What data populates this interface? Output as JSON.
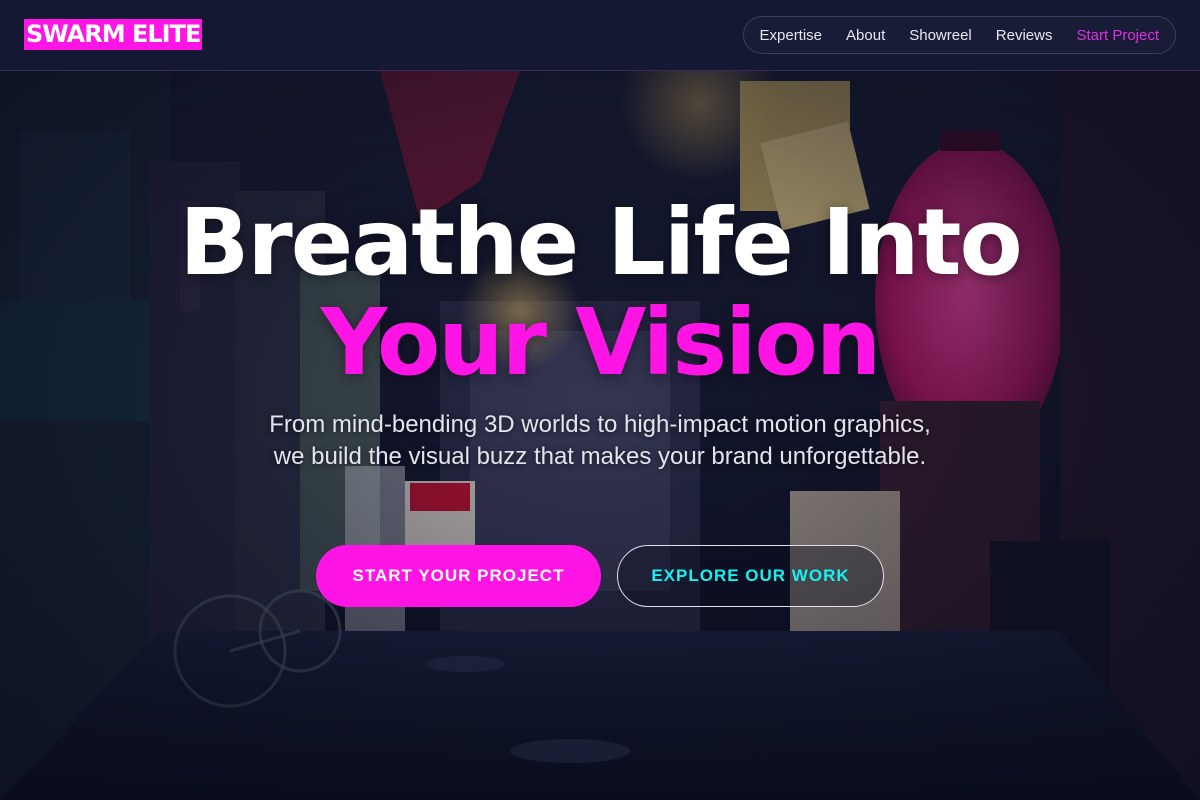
{
  "brand": {
    "logo_text": "SWARM ELITE",
    "accent": "#ff14e6",
    "cyan": "#19f0f0"
  },
  "nav": {
    "items": [
      {
        "label": "Expertise"
      },
      {
        "label": "About"
      },
      {
        "label": "Showreel"
      },
      {
        "label": "Reviews"
      },
      {
        "label": "Start Project"
      }
    ]
  },
  "hero": {
    "headline_line1": "Breathe Life Into",
    "headline_line2": "Your Vision",
    "subtitle": "From mind-bending 3D worlds to high-impact motion graphics, we build the visual buzz that makes your brand unforgettable.",
    "primary_cta": "START YOUR PROJECT",
    "secondary_cta": "EXPLORE OUR WORK",
    "background_image": "neon-alley-photo"
  }
}
